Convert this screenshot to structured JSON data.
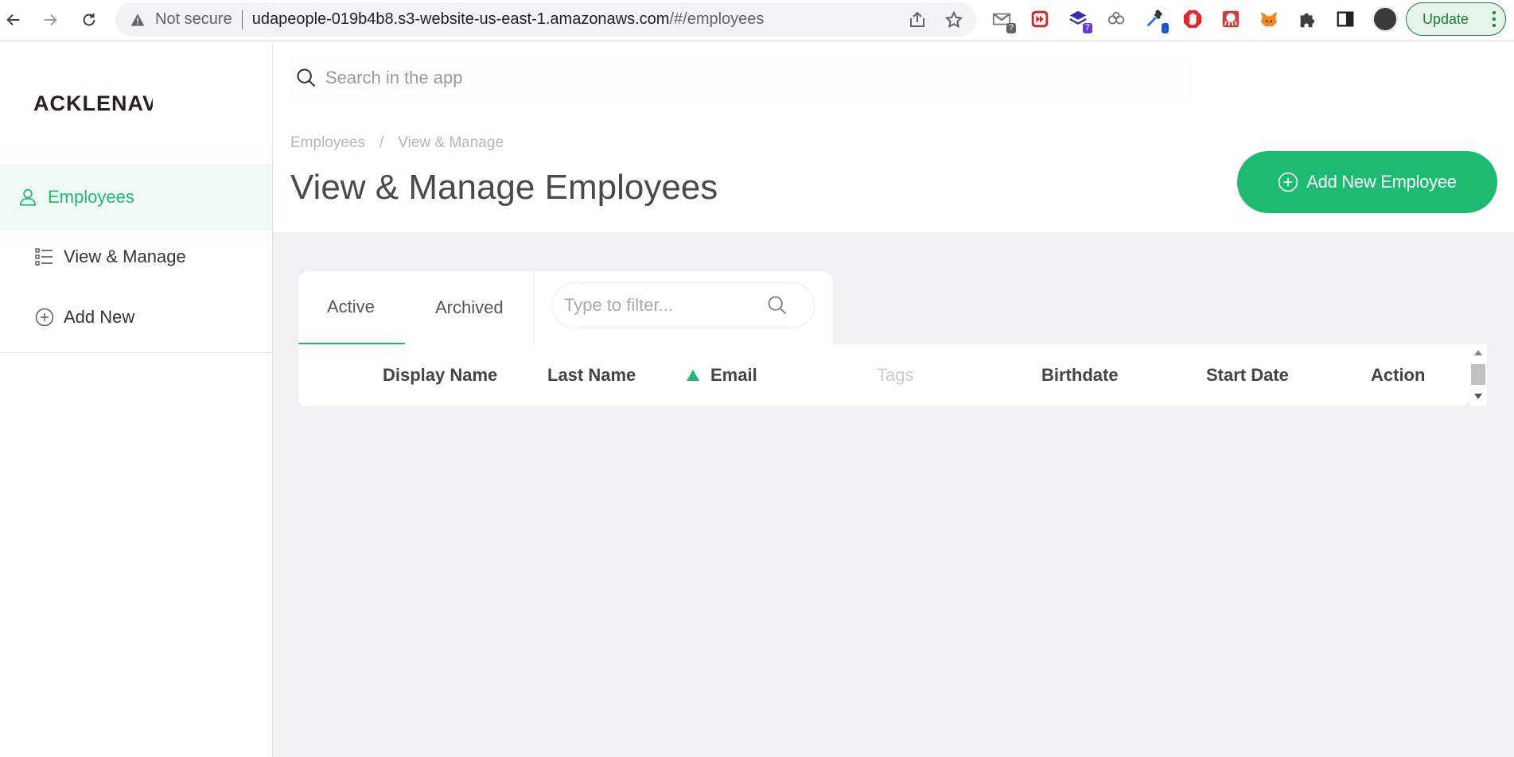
{
  "browser": {
    "security_label": "Not secure",
    "url_host": "udapeople-019b4b8.s3-website-us-east-1.amazonaws.com",
    "url_path": "/#/employees",
    "update_label": "Update",
    "extensions": [
      {
        "name": "gmail-checker-icon",
        "badge": "?"
      },
      {
        "name": "video-speed-icon",
        "badge": ""
      },
      {
        "name": "stack-icon",
        "badge": "7"
      },
      {
        "name": "link-chain-icon",
        "badge": ""
      },
      {
        "name": "eyedropper-icon",
        "badge": "."
      },
      {
        "name": "adblock-icon",
        "badge": ""
      },
      {
        "name": "octopus-icon",
        "badge": ""
      },
      {
        "name": "metamask-fox-icon",
        "badge": ""
      },
      {
        "name": "puzzle-extensions-icon",
        "badge": ""
      },
      {
        "name": "side-panel-icon",
        "badge": ""
      }
    ]
  },
  "app": {
    "logo_text": "ACKLENAVENUE",
    "search_placeholder": "Search in the app",
    "sidebar": {
      "main_item": "Employees",
      "items": [
        {
          "label": "View & Manage",
          "icon": "list-icon"
        },
        {
          "label": "Add New",
          "icon": "plus-circle-icon"
        }
      ]
    },
    "breadcrumb": [
      "Employees",
      "/",
      "View & Manage"
    ],
    "page_title": "View & Manage Employees",
    "add_button_label": "Add New Employee",
    "tabs": [
      "Active",
      "Archived"
    ],
    "filter_placeholder": "Type to filter...",
    "table": {
      "columns": [
        "Display Name",
        "Last Name",
        "Email",
        "Tags",
        "Birthdate",
        "Start Date",
        "Action"
      ],
      "sorted_column": "Email",
      "sort_direction": "ascending"
    }
  },
  "colors": {
    "accent": "#1dbb72",
    "content_bg": "#eef0f1"
  }
}
